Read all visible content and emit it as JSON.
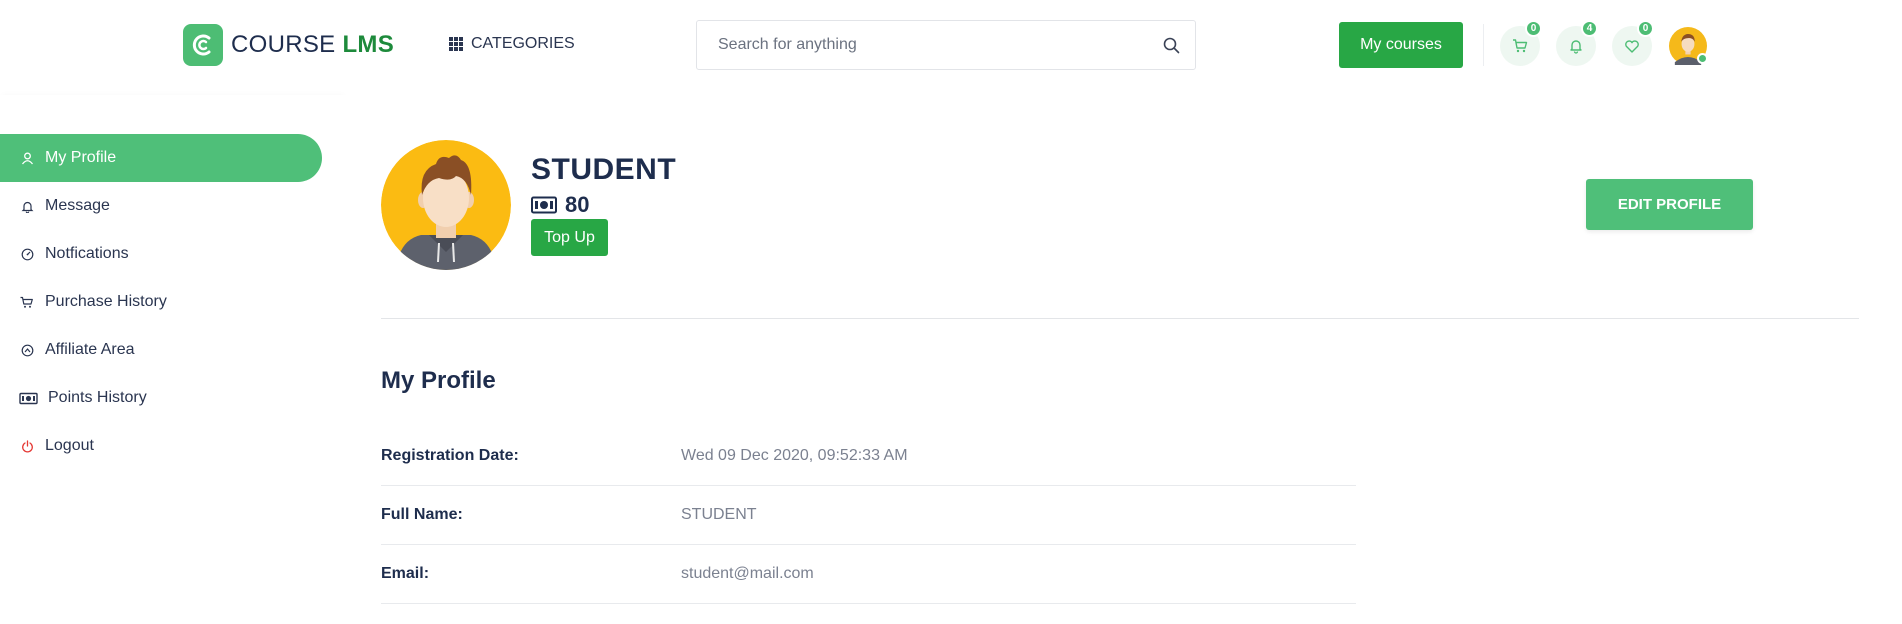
{
  "header": {
    "logo_prefix": "COURSE",
    "logo_suffix": "LMS",
    "categories_label": "CATEGORIES",
    "search_placeholder": "Search for anything",
    "my_courses_label": "My courses",
    "cart_count": "0",
    "notifications_count": "4",
    "wishlist_count": "0"
  },
  "sidebar": {
    "items": [
      {
        "label": "My Profile",
        "icon": "user-icon"
      },
      {
        "label": "Message",
        "icon": "bell-icon"
      },
      {
        "label": "Notfications",
        "icon": "dashboard-icon"
      },
      {
        "label": "Purchase History",
        "icon": "cart-icon"
      },
      {
        "label": "Affiliate Area",
        "icon": "affiliate-icon"
      },
      {
        "label": "Points History",
        "icon": "money-icon"
      },
      {
        "label": "Logout",
        "icon": "power-icon"
      }
    ]
  },
  "profile": {
    "name": "STUDENT",
    "points": "80",
    "topup_label": "Top Up",
    "edit_label": "EDIT PROFILE"
  },
  "details": {
    "title": "My Profile",
    "rows": [
      {
        "label": "Registration Date:",
        "value": "Wed 09 Dec 2020, 09:52:33 AM"
      },
      {
        "label": "Full Name:",
        "value": "STUDENT"
      },
      {
        "label": "Email:",
        "value": "student@mail.com"
      }
    ]
  },
  "colors": {
    "brand_green": "#28a745",
    "accent_green": "#4fbf79",
    "text_dark": "#1e2d4d",
    "logout_red": "#e53935"
  }
}
